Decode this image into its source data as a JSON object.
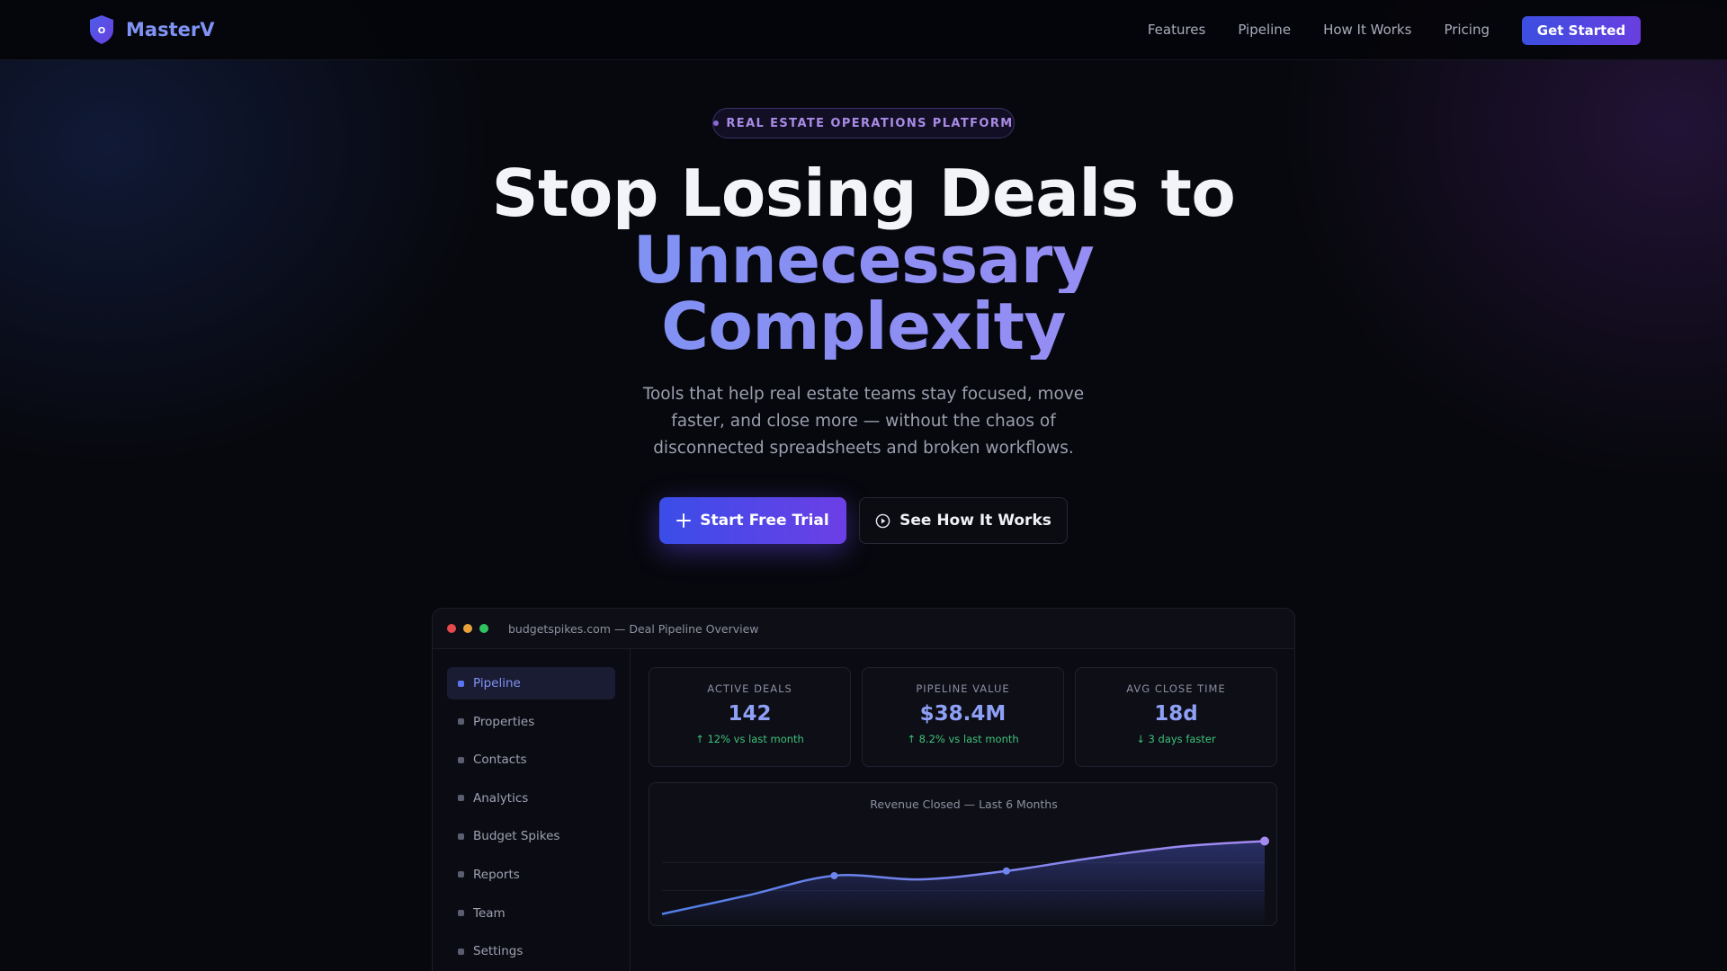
{
  "brand": {
    "name": "MasterV",
    "logo_letter": "O",
    "logo_icon": "shield-icon"
  },
  "nav": {
    "links": [
      "Features",
      "Pipeline",
      "How It Works",
      "Pricing"
    ],
    "cta": "Get Started"
  },
  "hero": {
    "badge": "REAL ESTATE OPERATIONS PLATFORM",
    "title_line1": "Stop Losing Deals to",
    "title_line2": "Unnecessary",
    "title_line3": "Complexity",
    "subtitle": "Tools that help real estate teams stay focused, move faster, and close more — without the chaos of disconnected spreadsheets and broken workflows.",
    "primary_button": "Start Free Trial",
    "primary_icon": "plus-icon",
    "secondary_button": "See How It Works",
    "secondary_icon": "play-circle-icon"
  },
  "dashboard": {
    "window_title": "budgetspikes.com — Deal Pipeline Overview",
    "sidebar": [
      {
        "label": "Pipeline",
        "active": true
      },
      {
        "label": "Properties",
        "active": false
      },
      {
        "label": "Contacts",
        "active": false
      },
      {
        "label": "Analytics",
        "active": false
      },
      {
        "label": "Budget Spikes",
        "active": false
      },
      {
        "label": "Reports",
        "active": false
      },
      {
        "label": "Team",
        "active": false
      },
      {
        "label": "Settings",
        "active": false
      }
    ],
    "stats": [
      {
        "label": "ACTIVE DEALS",
        "value": "142",
        "delta": "↑ 12% vs last month"
      },
      {
        "label": "PIPELINE VALUE",
        "value": "$38.4M",
        "delta": "↑ 8.2% vs last month"
      },
      {
        "label": "AVG CLOSE TIME",
        "value": "18d",
        "delta": "↓ 3 days faster"
      }
    ]
  },
  "colors": {
    "accent": "#5b74f0",
    "accent_purple": "#6c3fe6",
    "positive": "#3ec27a",
    "line": "#6f86f0"
  },
  "chart_data": {
    "type": "area",
    "title": "Revenue Closed — Last 6 Months",
    "x": [
      0,
      1,
      2,
      3,
      4,
      5,
      6,
      7
    ],
    "values": [
      10,
      30,
      51,
      47,
      56,
      70,
      82,
      88
    ],
    "highlighted_points": [
      2,
      4,
      7
    ],
    "ylim": [
      0,
      100
    ],
    "grid": true
  }
}
